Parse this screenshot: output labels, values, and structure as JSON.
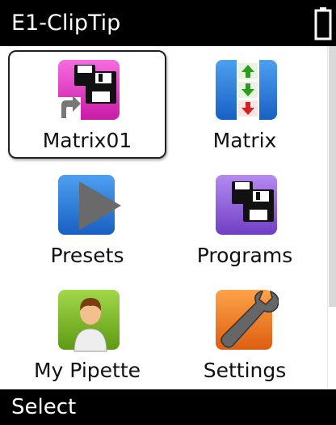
{
  "header": {
    "title": "E1-ClipTip"
  },
  "tiles": [
    {
      "label": "Matrix01"
    },
    {
      "label": "Matrix"
    },
    {
      "label": "Presets"
    },
    {
      "label": "Programs"
    },
    {
      "label": "My Pipette"
    },
    {
      "label": "Settings"
    }
  ],
  "footer": {
    "softkey_label": "Select"
  },
  "colors": {
    "magenta": "#e52fc9",
    "blue": "#1e74d6",
    "purple": "#8a5bd6",
    "green": "#7ab51d",
    "orange": "#ee7a1d"
  }
}
